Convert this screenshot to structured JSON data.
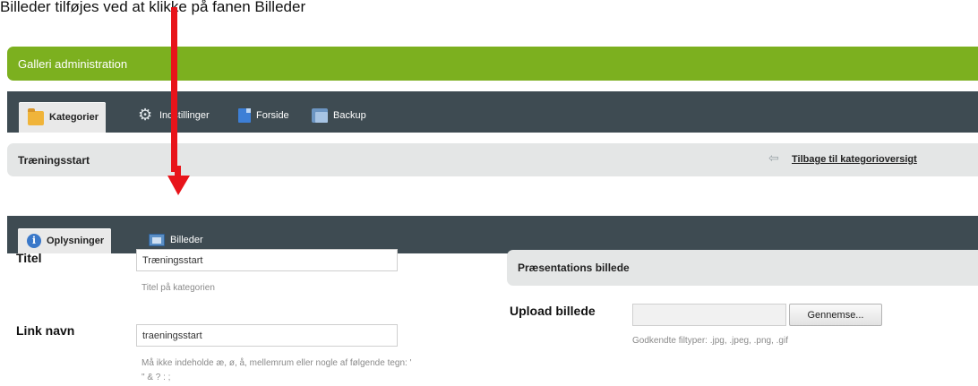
{
  "caption": "Billeder tilføjes ved at klikke på fanen Billeder",
  "title_bar": {
    "title": "Galleri administration"
  },
  "main_nav": {
    "items": [
      {
        "label": "Kategorier",
        "icon": "folder-icon",
        "active": true
      },
      {
        "label": "Indstillinger",
        "icon": "gear-icon",
        "active": false
      },
      {
        "label": "Forside",
        "icon": "page-icon",
        "active": false
      },
      {
        "label": "Backup",
        "icon": "backup-icon",
        "active": false
      }
    ]
  },
  "page_header": {
    "title": "Træningsstart",
    "back_link": "Tilbage til kategorioversigt",
    "back_icon": "arrow-left-icon"
  },
  "tabs": [
    {
      "label": "Oplysninger",
      "icon": "info-icon",
      "active": true
    },
    {
      "label": "Billeder",
      "icon": "images-icon",
      "active": false
    }
  ],
  "form": {
    "title": {
      "label": "Titel",
      "value": "Træningsstart",
      "hint": "Titel på kategorien"
    },
    "link_name": {
      "label": "Link navn",
      "value": "traeningsstart",
      "hint_line1": "Må ikke indeholde æ, ø, å, mellemrum eller nogle af følgende tegn: '",
      "hint_line2": "\" & ? : ;"
    }
  },
  "presentation": {
    "heading": "Præsentations billede",
    "upload_label": "Upload billede",
    "browse_label": "Gennemse...",
    "allowed_types": "Godkendte filtyper: .jpg, .jpeg, .png, .gif"
  },
  "colors": {
    "title_bar": "#7cb01f",
    "nav_bar": "#3e4b52",
    "header_bar": "#e4e6e6",
    "annotation_arrow": "#e8141a"
  }
}
